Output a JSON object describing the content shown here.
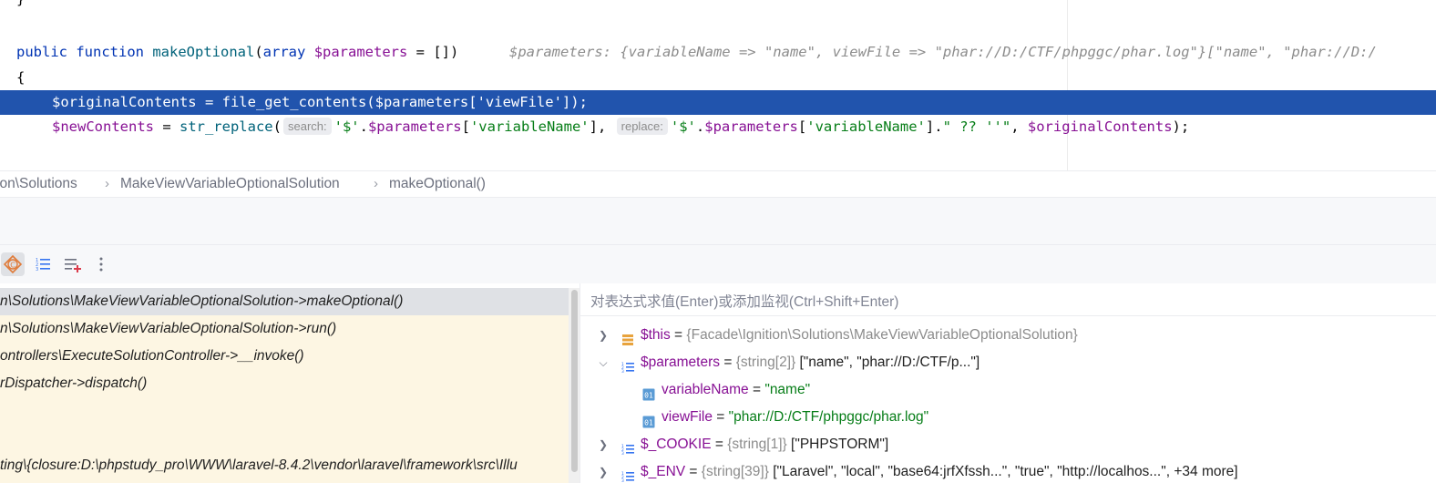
{
  "editor": {
    "line0": "}",
    "line1": {
      "kw1": "public",
      "kw2": "function",
      "fn": "makeOptional",
      "p1": "(",
      "kw3": "array",
      "var": "$parameters",
      "rest": " = [])",
      "hint": "$parameters: {variableName => \"name\", viewFile => \"phar://D:/CTF/phpggc/phar.log\"}[\"name\", \"phar://D:/"
    },
    "line2": "{",
    "line3": "$originalContents = file_get_contents($parameters['viewFile']);",
    "line4": {
      "var1": "$newContents",
      "eq": " = ",
      "fn": "str_replace",
      "p1": "(",
      "inlay1": "search:",
      "s1": "'$'",
      "dot1": ".",
      "var2": "$parameters",
      "b1": "[",
      "s2": "'variableName'",
      "b2": "],",
      "inlay2": "replace:",
      "s3": "'$'",
      "dot2": ".",
      "var3": "$parameters",
      "b3": "[",
      "s4": "'variableName'",
      "b4": "].",
      "s5": "\" ?? ''\"",
      "comma": ", ",
      "var4": "$originalContents",
      "end": ");"
    }
  },
  "breadcrumb": {
    "items": [
      "ion\\Solutions",
      "MakeViewVariableOptionalSolution",
      "makeOptional()"
    ],
    "separator": "›"
  },
  "toolbar": {
    "icons": [
      "threads-icon",
      "numbered-list-icon",
      "add-list-icon",
      "more-icon"
    ]
  },
  "frames": [
    "n\\Solutions\\MakeViewVariableOptionalSolution->makeOptional()",
    "n\\Solutions\\MakeViewVariableOptionalSolution->run()",
    "ontrollers\\ExecuteSolutionController->__invoke()",
    "rDispatcher->dispatch()",
    "",
    "",
    "ting\\{closure:D:\\phpstudy_pro\\WWW\\laravel-8.4.2\\vendor\\laravel\\framework\\src\\Illu"
  ],
  "variables": {
    "eval_placeholder": "对表达式求值(Enter)或添加监视(Ctrl+Shift+Enter)",
    "eq": " = ",
    "rows": [
      {
        "name": "$this",
        "type": "{Facade\\Ignition\\Solutions\\MakeViewVariableOptionalSolution}",
        "value": ""
      },
      {
        "name": "$parameters",
        "type": "{string[2]}",
        "value": " [\"name\", \"phar://D:/CTF/p...\"]"
      },
      {
        "name": "variableName",
        "value": "\"name\""
      },
      {
        "name": "viewFile",
        "value": "\"phar://D:/CTF/phpggc/phar.log\""
      },
      {
        "name": "$_COOKIE",
        "type": "{string[1]}",
        "value": " [\"PHPSTORM\"]"
      },
      {
        "name": "$_ENV",
        "type": "{string[39]}",
        "value": " [\"Laravel\", \"local\", \"base64:jrfXfssh...\", \"true\", \"http://localhos...\", +34 more]"
      }
    ],
    "field_badge": "01"
  },
  "colors": {
    "selection": "#2154ad",
    "frames_bg": "#fdf6e3",
    "keyword": "#0033b3",
    "string": "#067d17",
    "variable": "#871094",
    "function": "#00627a"
  }
}
